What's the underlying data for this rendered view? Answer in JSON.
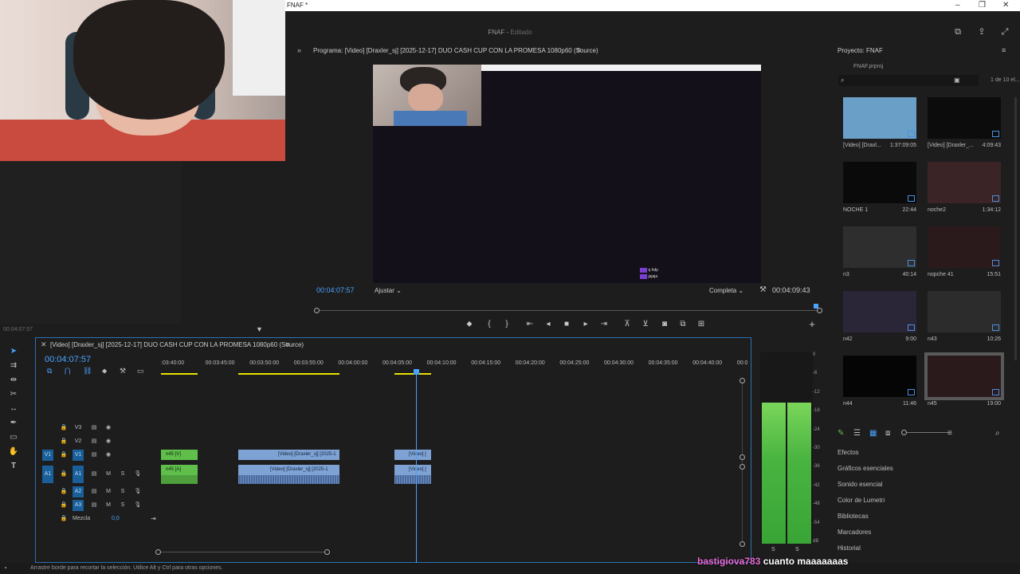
{
  "window": {
    "title": "FNAF *",
    "controls": [
      "–",
      "❐",
      "✕"
    ]
  },
  "header": {
    "doc_name": "FNAF",
    "doc_state": "Editado"
  },
  "left_panel": {
    "timecode": "00:04:07:57"
  },
  "program_monitor": {
    "title": "Programa: [Video] [Draxler_sj] [2025-12-17] DUO CASH CUP CON LA PROMESA 1080p60 (Source)",
    "timecode_current": "00:04:07:57",
    "fit": "Ajustar",
    "quality": "Completa",
    "timecode_duration": "00:04:09:43",
    "chat_lines": [
      "q hdp",
      "jajaja"
    ],
    "controls": [
      "marker-icon",
      "mark-in-icon",
      "mark-out-icon",
      "go-to-in-icon",
      "step-back-icon",
      "stop-icon",
      "play-icon",
      "step-forward-icon",
      "lift-icon",
      "extract-icon",
      "export-frame-icon",
      "compare-icon",
      "multicam-icon"
    ],
    "progress": 1.0
  },
  "project": {
    "title": "Proyecto: FNAF",
    "file": "FNAF.prproj",
    "count": "1 de 10 el...",
    "items": [
      {
        "label": "[Video] [Draxl...",
        "duration": "1:37:09:05",
        "thumb": "#6aa0c8"
      },
      {
        "label": "[Video] [Draxler_...",
        "duration": "4:09:43",
        "thumb": "#0c0c0c"
      },
      {
        "label": "NOCHE 1",
        "duration": "22:44",
        "thumb": "#0a0a0a"
      },
      {
        "label": "noche2",
        "duration": "1:34:12",
        "thumb": "#3a2426"
      },
      {
        "label": "n3",
        "duration": "40:14",
        "thumb": "#2e2e2e"
      },
      {
        "label": "nopche 41",
        "duration": "15:51",
        "thumb": "#2a1a1c"
      },
      {
        "label": "n42",
        "duration": "9:00",
        "thumb": "#2a2638"
      },
      {
        "label": "n43",
        "duration": "10:26",
        "thumb": "#2c2c2c"
      },
      {
        "label": "n44",
        "duration": "11:46",
        "thumb": "#050505"
      },
      {
        "label": "n45",
        "duration": "19:00",
        "thumb": "#2a1a1c"
      }
    ]
  },
  "panels": [
    "Efectos",
    "Gráficos esenciales",
    "Sonido esencial",
    "Color de Lumetri",
    "Bibliotecas",
    "Marcadores",
    "Historial"
  ],
  "timeline": {
    "title": "[Video] [Draxler_sj] [2025-12-17] DUO CASH CUP CON LA PROMESA 1080p60 (Source)",
    "timecode": "00:04:07:57",
    "ticks": [
      ":03:40:00",
      "00:03:45:00",
      "00:03:50:00",
      "00:03:55:00",
      "00:04:00:00",
      "00:04:05:00",
      "00:04:10:00",
      "00:04:15:00",
      "00:04:20:00",
      "00:04:25:00",
      "00:04:30:00",
      "00:04:35:00",
      "00:04:40:00",
      "00:0"
    ],
    "tracks": {
      "v3": "V3",
      "v2": "V2",
      "v1": "V1",
      "v1_src": "V1",
      "a1": "A1",
      "a1_src": "A1",
      "a2": "A2",
      "a3": "A3",
      "mix": "Mezcla",
      "mix_value": "0,0",
      "m": "M",
      "s": "S"
    },
    "clips": {
      "n45v": "n45 [V]",
      "n45a": "n45 [A]",
      "vid1": "[Video] [Draxler_sj] [2025-1",
      "vid1a": "[Video] [Draxler_sj] [2025-1",
      "vid2": "[Video] [",
      "vid2a": "[Video] ["
    }
  },
  "meter": {
    "scale": [
      "0",
      "-6",
      "-12",
      "-18",
      "-24",
      "-30",
      "-36",
      "-42",
      "-48",
      "-54",
      "dB"
    ],
    "solo_labels": [
      "S",
      "S"
    ],
    "level_db": -18
  },
  "status": "Arrastre borde para recortar la selección. Utilice Alt y Ctrl para otras opciones.",
  "chat": {
    "user": "bastigiova783",
    "message": "cuanto maaaaaaas"
  }
}
